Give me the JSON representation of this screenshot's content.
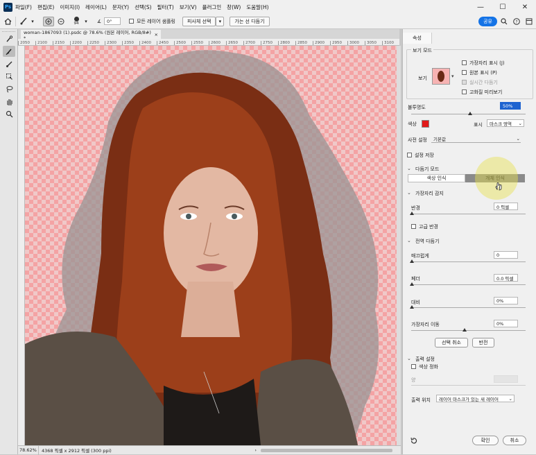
{
  "menubar": {
    "logo": "Ps",
    "items": [
      "파일(F)",
      "편집(E)",
      "이미지(I)",
      "레이어(L)",
      "문자(Y)",
      "선택(S)",
      "필터(T)",
      "보기(V)",
      "플러그인",
      "창(W)",
      "도움말(H)"
    ],
    "win_min": "—",
    "win_max": "☐",
    "win_close": "✕"
  },
  "options": {
    "brush_size": "94",
    "angle": "0°",
    "sample_all_layers": "모든 레이어 샘플링",
    "object_select": "피사체 선택",
    "refine_hair": "가는 선 다듬기",
    "share": "공유"
  },
  "document": {
    "tab_title": "woman-1867093 (1).psdc @ 78.6% (원본 레이어, RGB/8#) *",
    "ruler_marks": [
      "2050",
      "2100",
      "2150",
      "2200",
      "2250",
      "2300",
      "2350",
      "2400",
      "2450",
      "2500",
      "2550",
      "2600",
      "2650",
      "2700",
      "2750",
      "2800",
      "2850",
      "2900",
      "2950",
      "3000",
      "3050",
      "3100"
    ],
    "zoom": "78.62%",
    "doc_info": "4368 픽셀 x 2912 픽셀 (300 ppi)"
  },
  "panel": {
    "tab": "속성",
    "view_mode": "보기 모드",
    "view_label": "보기",
    "show_edge": "가장자리 표시 (J)",
    "show_original": "원본 표시 (P)",
    "realtime": "실시간 다듬기",
    "hq_preview": "고화질 미리보기",
    "opacity_label": "불투명도",
    "opacity_value": "50%",
    "opacity_level": 0.5,
    "color_label": "색상",
    "mask_color": "#e11a1a",
    "display_label": "표시",
    "display_value": "마스크 영역",
    "preset_label": "사전 설정",
    "preset_value": "기본값",
    "save_settings": "설정 저장",
    "refine_mode": "다듬기 모드",
    "mode_color": "색상 인식",
    "mode_object": "개체 인식",
    "edge_detect": "가장자리 감지",
    "radius_label": "반경",
    "radius_value": "0 픽셀",
    "smart_radius": "고급 반경",
    "global_refine": "전역 다듬기",
    "smooth_label": "매끄럽게",
    "smooth_value": "0",
    "feather_label": "페더",
    "feather_value": "0.0 픽셀",
    "contrast_label": "대비",
    "contrast_value": "0%",
    "shift_label": "가장자리 이동",
    "shift_value": "0%",
    "deselect": "선택 취소",
    "invert": "반전",
    "output_settings": "출력 설정",
    "decontam": "색상 정화",
    "amount_label": "양",
    "output_to_label": "출력 위치",
    "output_to_value": "레이어 마스크가 있는 새 레이어",
    "ok": "확인",
    "cancel": "취소"
  }
}
